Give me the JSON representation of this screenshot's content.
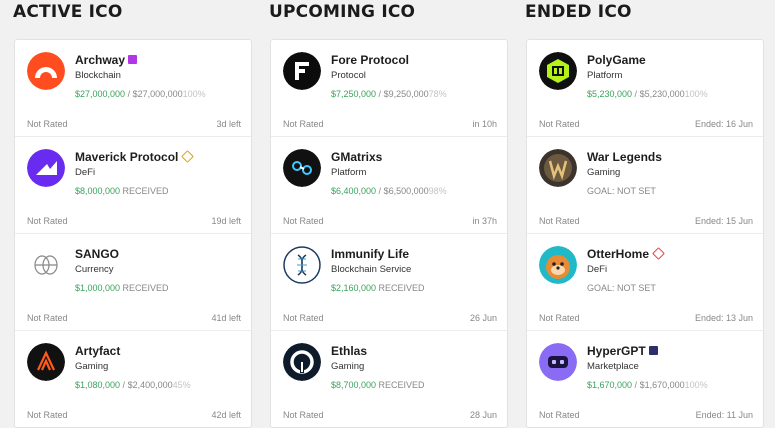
{
  "columns": [
    {
      "title": "ACTIVE ICO",
      "items": [
        {
          "name": "Archway",
          "badge": "purple",
          "category": "Blockchain",
          "raised": "$27,000,000",
          "sep": " / ",
          "goal": "$27,000,000",
          "pct": "100%",
          "status": "",
          "rating": "Not Rated",
          "time": "3d left",
          "icon": "archway-logo"
        },
        {
          "name": "Maverick Protocol",
          "badge": "diamond",
          "category": "DeFi",
          "raised": "$8,000,000",
          "sep": "",
          "goal": "",
          "pct": "",
          "status": " RECEIVED",
          "rating": "Not Rated",
          "time": "19d left",
          "icon": "maverick-logo"
        },
        {
          "name": "SANGO",
          "badge": "",
          "category": "Currency",
          "raised": "$1,000,000",
          "sep": "",
          "goal": "",
          "pct": "",
          "status": " RECEIVED",
          "rating": "Not Rated",
          "time": "41d left",
          "icon": "sango-logo"
        },
        {
          "name": "Artyfact",
          "badge": "",
          "category": "Gaming",
          "raised": "$1,080,000",
          "sep": " / ",
          "goal": "$2,400,000",
          "pct": "45%",
          "status": "",
          "rating": "Not Rated",
          "time": "42d left",
          "icon": "artyfact-logo"
        }
      ]
    },
    {
      "title": "UPCOMING ICO",
      "items": [
        {
          "name": "Fore Protocol",
          "badge": "",
          "category": "Protocol",
          "raised": "$7,250,000",
          "sep": " / ",
          "goal": "$9,250,000",
          "pct": "78%",
          "status": "",
          "rating": "Not Rated",
          "time": "in 10h",
          "icon": "fore-logo"
        },
        {
          "name": "GMatrixs",
          "badge": "",
          "category": "Platform",
          "raised": "$6,400,000",
          "sep": " / ",
          "goal": "$6,500,000",
          "pct": "98%",
          "status": "",
          "rating": "Not Rated",
          "time": "in 37h",
          "icon": "gmatrixs-logo"
        },
        {
          "name": "Immunify Life",
          "badge": "",
          "category": "Blockchain Service",
          "raised": "$2,160,000",
          "sep": "",
          "goal": "",
          "pct": "",
          "status": " RECEIVED",
          "rating": "Not Rated",
          "time": "26 Jun",
          "icon": "immunify-logo"
        },
        {
          "name": "Ethlas",
          "badge": "",
          "category": "Gaming",
          "raised": "$8,700,000",
          "sep": "",
          "goal": "",
          "pct": "",
          "status": " RECEIVED",
          "rating": "Not Rated",
          "time": "28 Jun",
          "icon": "ethlas-logo"
        }
      ]
    },
    {
      "title": "ENDED ICO",
      "items": [
        {
          "name": "PolyGame",
          "badge": "",
          "category": "Platform",
          "raised": "$5,230,000",
          "sep": " / ",
          "goal": "$5,230,000",
          "pct": "100%",
          "status": "",
          "rating": "Not Rated",
          "time": "Ended: 16 Jun",
          "icon": "polygame-logo"
        },
        {
          "name": "War Legends",
          "badge": "",
          "category": "Gaming",
          "raised": "",
          "sep": "",
          "goal": "",
          "pct": "",
          "status": "GOAL: NOT SET",
          "rating": "Not Rated",
          "time": "Ended: 15 Jun",
          "icon": "warlegends-logo"
        },
        {
          "name": "OtterHome",
          "badge": "reddiamond",
          "category": "DeFi",
          "raised": "",
          "sep": "",
          "goal": "",
          "pct": "",
          "status": "GOAL: NOT SET",
          "rating": "Not Rated",
          "time": "Ended: 13 Jun",
          "icon": "otterhome-logo"
        },
        {
          "name": "HyperGPT",
          "badge": "navy",
          "category": "Marketplace",
          "raised": "$1,670,000",
          "sep": " / ",
          "goal": "$1,670,000",
          "pct": "100%",
          "status": "",
          "rating": "Not Rated",
          "time": "Ended: 11 Jun",
          "icon": "hypergpt-logo"
        }
      ]
    }
  ]
}
